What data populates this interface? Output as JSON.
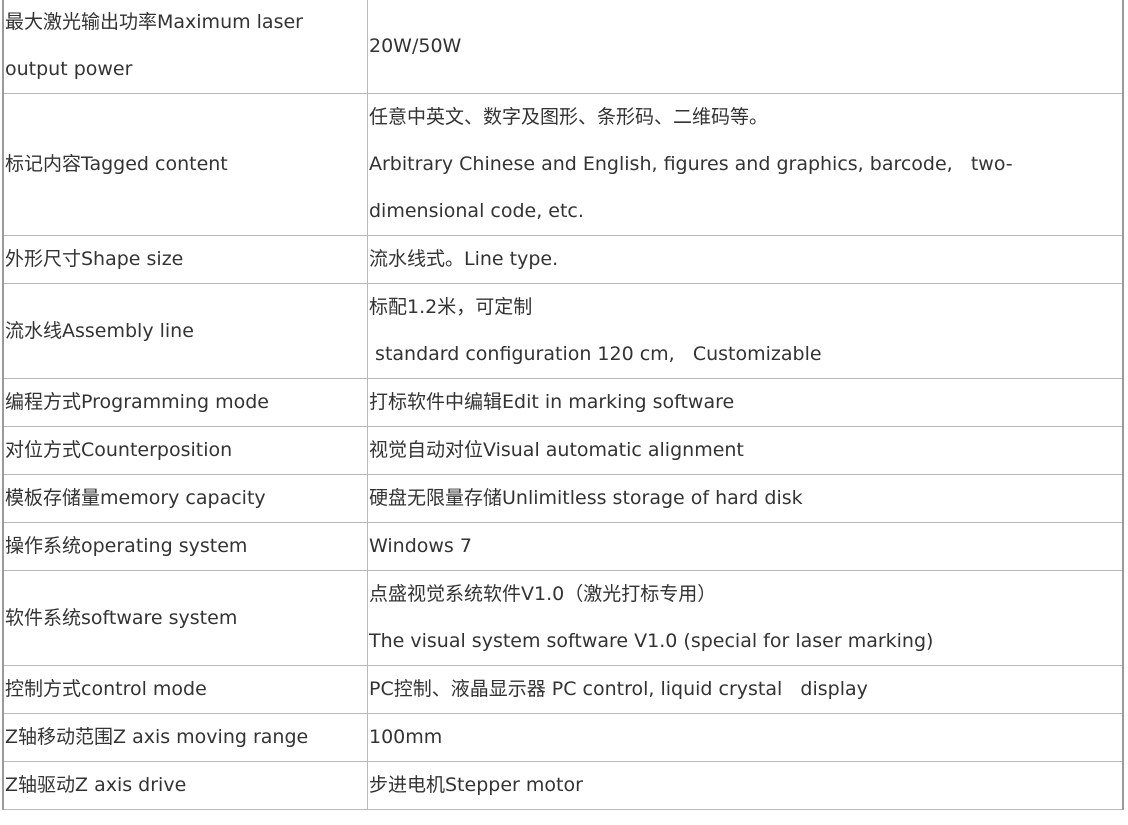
{
  "rows": [
    {
      "label": [
        "最大激光输出功率Maximum laser",
        "output power"
      ],
      "value": [
        "20W/50W"
      ]
    },
    {
      "label": [
        "标记内容Tagged content"
      ],
      "value": [
        "任意中英文、数字及图形、条形码、二维码等。",
        "Arbitrary Chinese and English, figures and graphics, barcode,   two-",
        "dimensional code, etc."
      ]
    },
    {
      "label": [
        "外形尺寸Shape size"
      ],
      "value": [
        "流水线式。Line type."
      ]
    },
    {
      "label": [
        "流水线Assembly line"
      ],
      "value": [
        "标配1.2米，可定制",
        " standard configuration 120 cm,   Customizable"
      ]
    },
    {
      "label": [
        "编程方式Programming mode"
      ],
      "value": [
        "打标软件中编辑Edit in marking software"
      ]
    },
    {
      "label": [
        "对位方式Counterposition"
      ],
      "value": [
        "视觉自动对位Visual automatic alignment"
      ]
    },
    {
      "label": [
        "模板存储量memory capacity"
      ],
      "value": [
        "硬盘无限量存储Unlimitless storage of hard disk"
      ]
    },
    {
      "label": [
        "操作系统operating system"
      ],
      "value": [
        "Windows 7"
      ]
    },
    {
      "label": [
        "软件系统software system"
      ],
      "value": [
        "点盛视觉系统软件V1.0（激光打标专用）",
        "The visual system software V1.0 (special for laser marking)"
      ]
    },
    {
      "label": [
        "控制方式control mode"
      ],
      "value": [
        "PC控制、液晶显示器 PC control, liquid crystal   display"
      ]
    },
    {
      "label": [
        "Z轴移动范围Z axis moving range"
      ],
      "value": [
        "100mm"
      ]
    },
    {
      "label": [
        "Z轴驱动Z axis drive"
      ],
      "value": [
        "步进电机Stepper motor"
      ]
    }
  ]
}
